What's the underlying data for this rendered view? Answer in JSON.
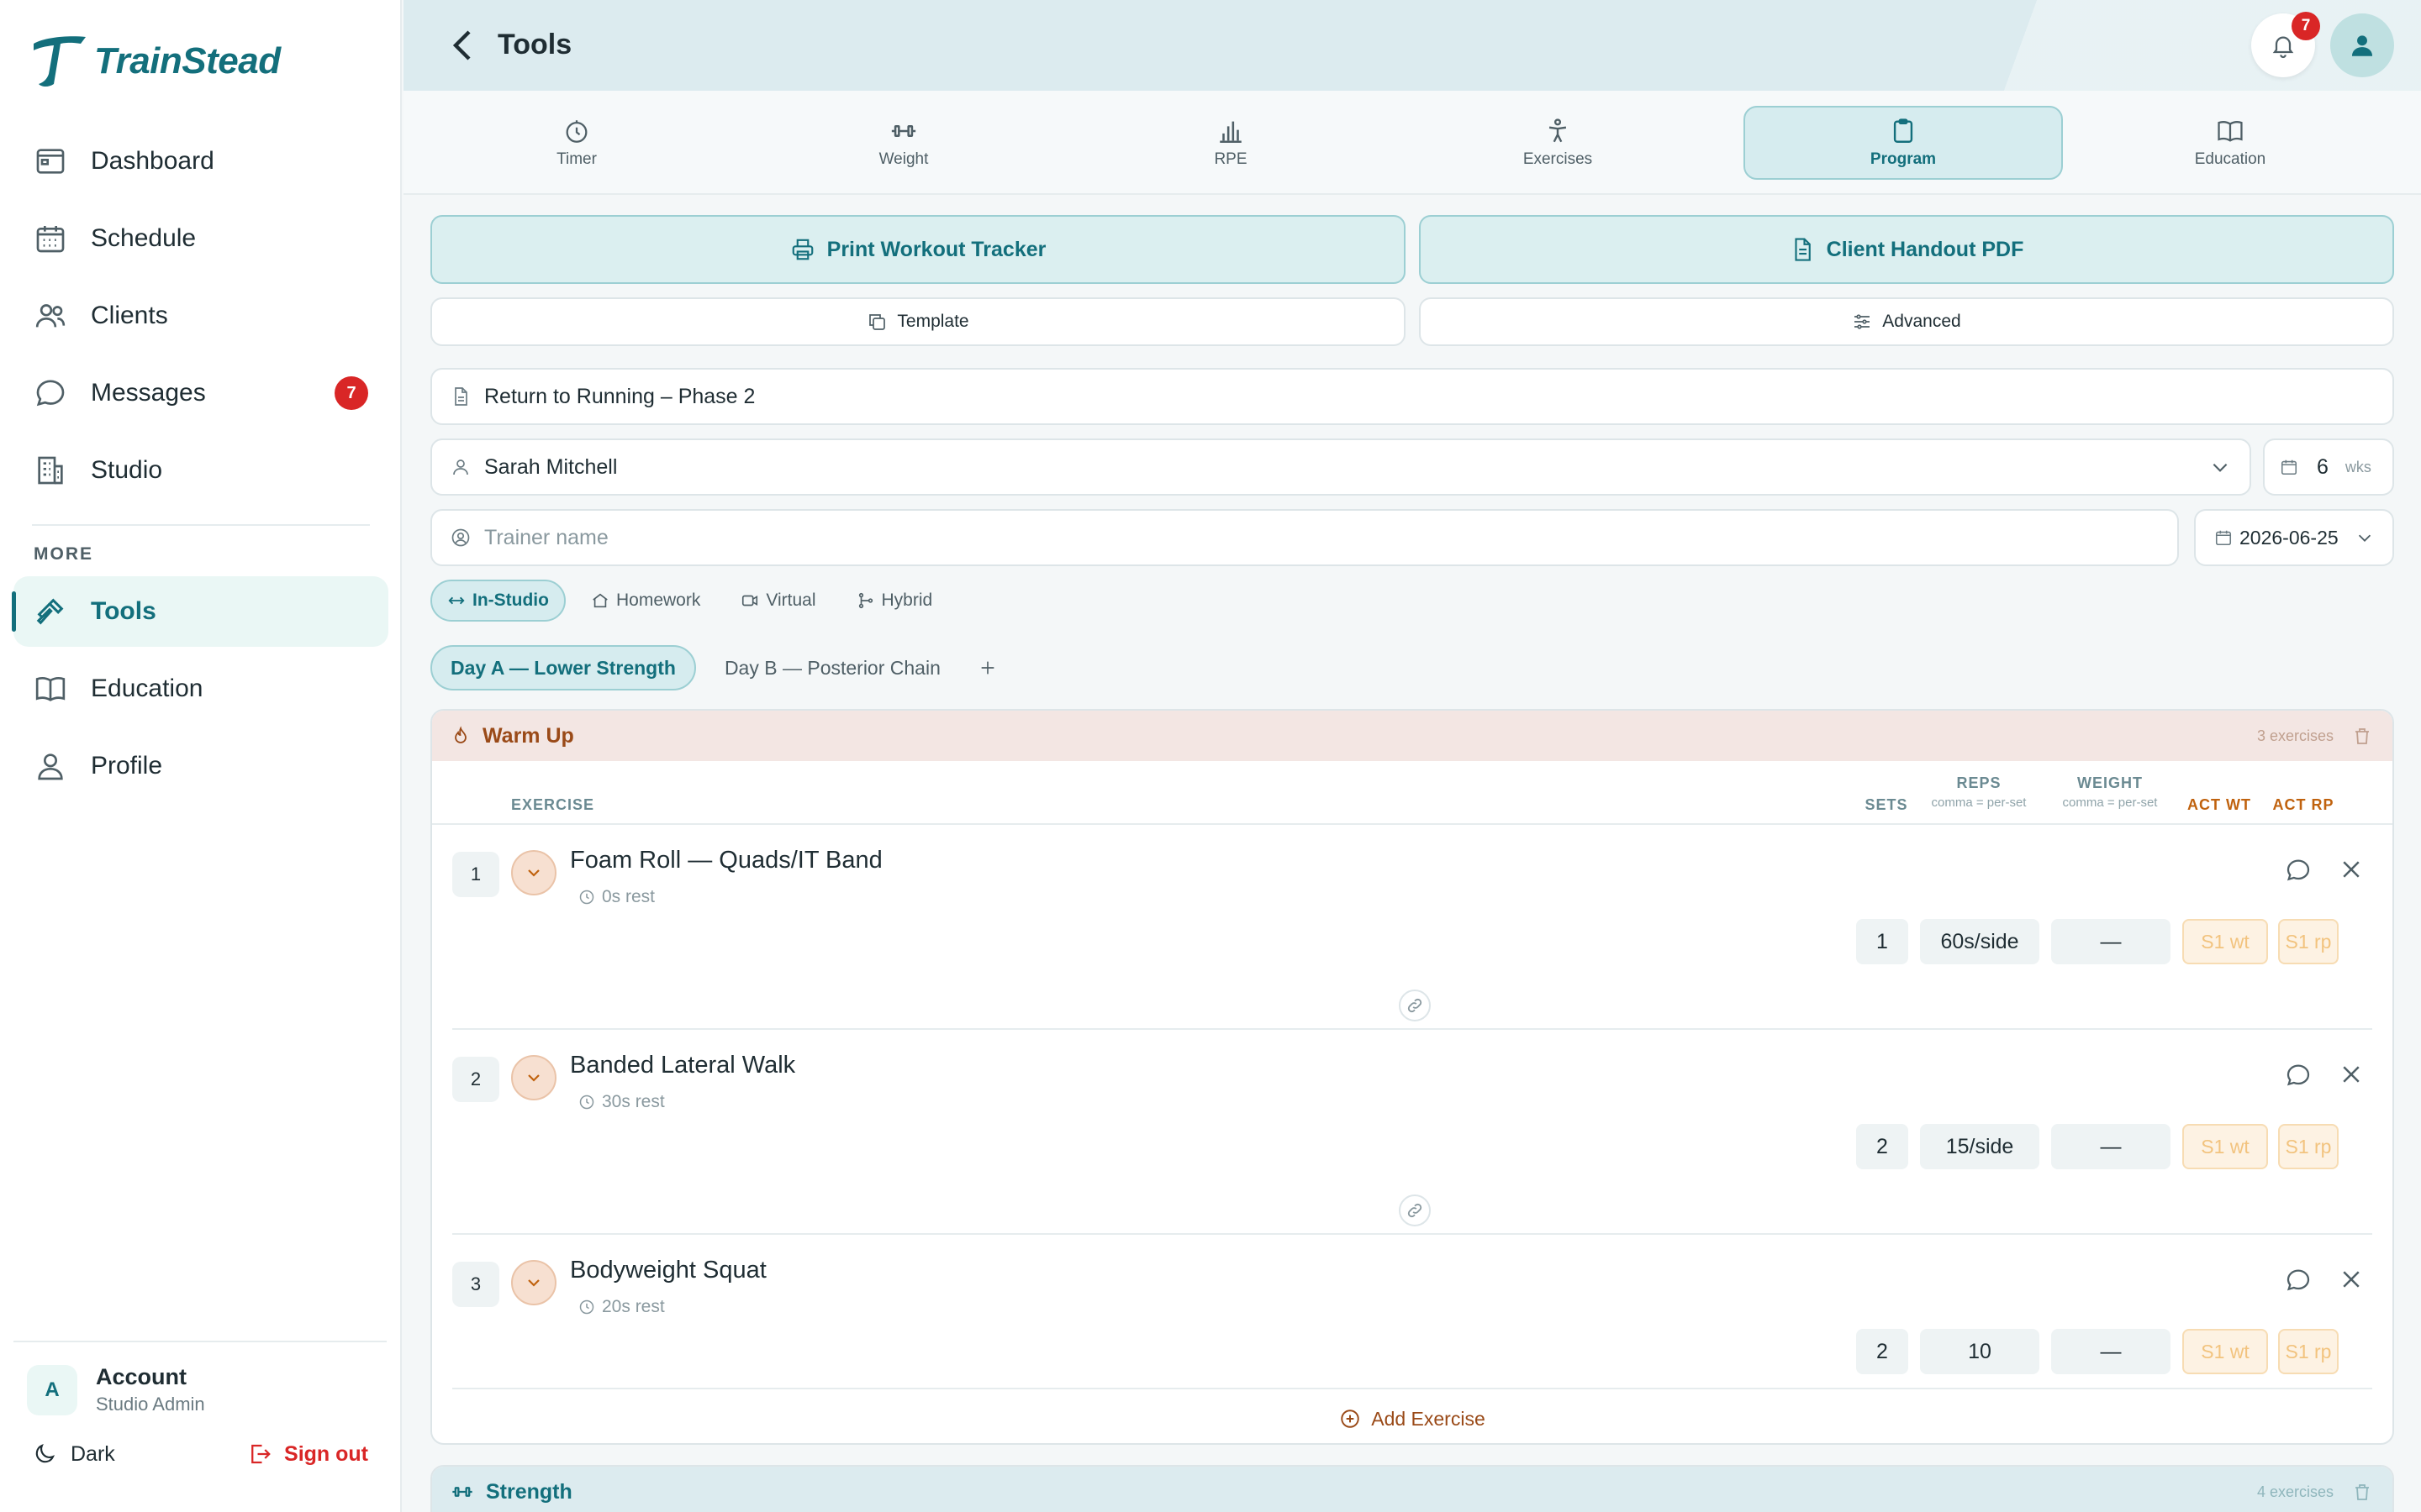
{
  "app": {
    "brand": "TrainStead"
  },
  "sidebar": {
    "items": [
      {
        "label": "Dashboard",
        "icon": "dashboard-icon"
      },
      {
        "label": "Schedule",
        "icon": "calendar-icon"
      },
      {
        "label": "Clients",
        "icon": "users-icon"
      },
      {
        "label": "Messages",
        "icon": "message-icon",
        "badge": "7"
      },
      {
        "label": "Studio",
        "icon": "building-icon"
      }
    ],
    "more_label": "MORE",
    "more_items": [
      {
        "label": "Tools",
        "icon": "hammer-icon",
        "active": true
      },
      {
        "label": "Education",
        "icon": "book-icon"
      },
      {
        "label": "Profile",
        "icon": "user-icon"
      }
    ],
    "account": {
      "avatar": "A",
      "name": "Account",
      "role": "Studio Admin"
    },
    "dark_label": "Dark",
    "signout_label": "Sign out"
  },
  "header": {
    "title": "Tools",
    "notifications": "7"
  },
  "tool_tabs": [
    {
      "label": "Timer",
      "icon": "timer-icon"
    },
    {
      "label": "Weight",
      "icon": "dumbbell-icon"
    },
    {
      "label": "RPE",
      "icon": "bar-chart-icon"
    },
    {
      "label": "Exercises",
      "icon": "person-icon"
    },
    {
      "label": "Program",
      "icon": "clipboard-icon",
      "active": true
    },
    {
      "label": "Education",
      "icon": "book-icon"
    }
  ],
  "actions": {
    "print_label": "Print Workout Tracker",
    "handout_label": "Client Handout PDF",
    "template_label": "Template",
    "advanced_label": "Advanced"
  },
  "program": {
    "name": "Return to Running – Phase 2",
    "client": "Sarah Mitchell",
    "weeks": "6",
    "weeks_unit": "wks",
    "trainer_placeholder": "Trainer name",
    "start_date": "2026-06-25"
  },
  "modes": [
    "In-Studio",
    "Homework",
    "Virtual",
    "Hybrid"
  ],
  "days": [
    "Day A — Lower Strength",
    "Day B — Posterior Chain"
  ],
  "columns": {
    "exercise": "EXERCISE",
    "sets": "SETS",
    "reps": "REPS",
    "reps_sub": "comma = per-set",
    "weight": "WEIGHT",
    "weight_sub": "comma = per-set",
    "act_wt": "ACT WT",
    "act_rp": "ACT RP"
  },
  "warmup": {
    "title": "Warm Up",
    "count": "3 exercises",
    "exercises": [
      {
        "num": "1",
        "name": "Foam Roll — Quads/IT Band",
        "rest": "0s rest",
        "sets": "1",
        "reps": "60s/side",
        "weight": "—",
        "act_wt": "S1 wt",
        "act_rp": "S1 rp"
      },
      {
        "num": "2",
        "name": "Banded Lateral Walk",
        "rest": "30s rest",
        "sets": "2",
        "reps": "15/side",
        "weight": "—",
        "act_wt": "S1 wt",
        "act_rp": "S1 rp"
      },
      {
        "num": "3",
        "name": "Bodyweight Squat",
        "rest": "20s rest",
        "sets": "2",
        "reps": "10",
        "weight": "—",
        "act_wt": "S1 wt",
        "act_rp": "S1 rp"
      }
    ],
    "add_label": "Add Exercise"
  },
  "strength": {
    "title": "Strength",
    "count": "4 exercises"
  },
  "colors": {
    "accent": "#136f7c",
    "warm": "#9a4a18",
    "danger": "#d92626"
  }
}
